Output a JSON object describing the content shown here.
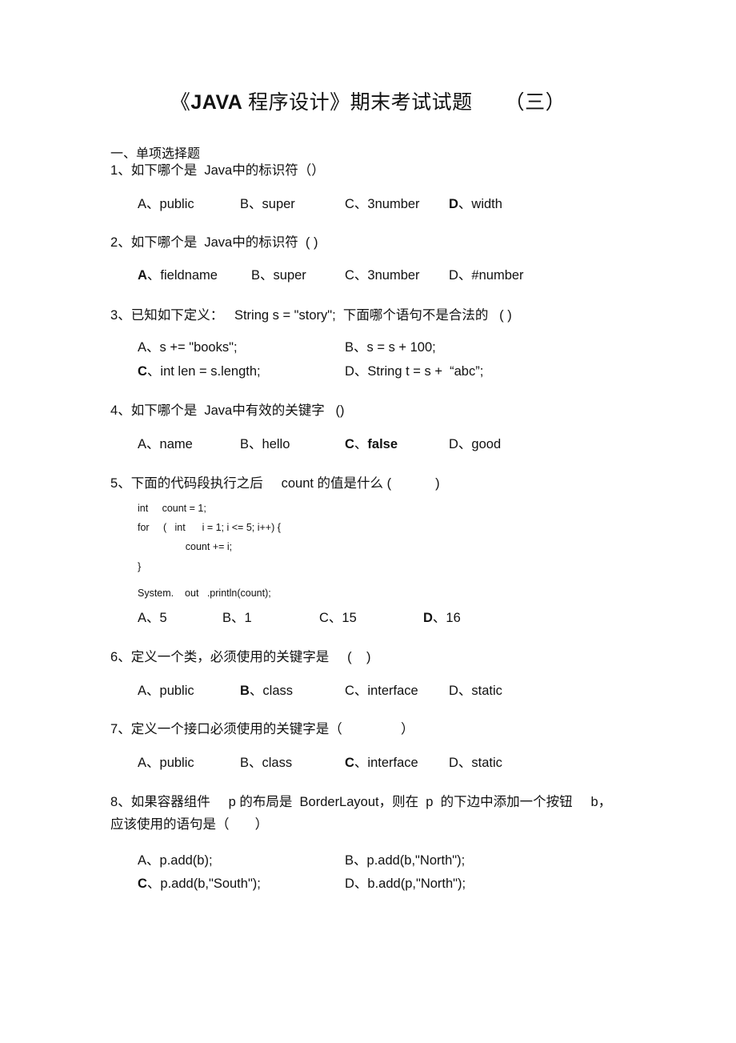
{
  "title": {
    "open": "《",
    "java": "JAVA",
    "rest": " 程序设计》期末考试试题",
    "suffix": "（三）"
  },
  "section": "一、单项选择题",
  "sep": "、",
  "questions": [
    {
      "number": "1",
      "text": "如下哪个是  Java中的标识符（）",
      "options": [
        {
          "letter": "A",
          "text": "public"
        },
        {
          "letter": "B",
          "text": "super"
        },
        {
          "letter": "C",
          "text": "3number"
        },
        {
          "letter": "D",
          "text": "width",
          "marked": true
        }
      ]
    },
    {
      "number": "2",
      "text": "如下哪个是  Java中的标识符  ( )",
      "options": [
        {
          "letter": "A",
          "text": "fieldname",
          "marked": true
        },
        {
          "letter": "B",
          "text": "super"
        },
        {
          "letter": "C",
          "text": "3number"
        },
        {
          "letter": "D",
          "text": "#number"
        }
      ]
    },
    {
      "number": "3",
      "text": "已知如下定义：   String s = \"story\";  下面哪个语句不是合法的   ( )",
      "options": [
        {
          "letter": "A",
          "text": "s += \"books\";"
        },
        {
          "letter": "B",
          "text": "s = s + 100;"
        },
        {
          "letter": "C",
          "text": "int len = s.length;",
          "marked": true
        },
        {
          "letter": "D",
          "text": "String t = s +  “abc”;"
        }
      ]
    },
    {
      "number": "4",
      "text": "如下哪个是  Java中有效的关键字   ()",
      "options": [
        {
          "letter": "A",
          "text": "name"
        },
        {
          "letter": "B",
          "text": "hello"
        },
        {
          "letter": "C",
          "text": "false",
          "marked": true
        },
        {
          "letter": "D",
          "text": "good"
        }
      ]
    },
    {
      "number": "5",
      "text": "下面的代码段执行之后     count 的值是什么 (            )",
      "code": [
        "int     count = 1;",
        "for     (   int      i = 1; i <= 5; i++) {",
        "        count += i;",
        "}",
        "System.    out   .println(count);"
      ],
      "options": [
        {
          "letter": "A",
          "text": "5"
        },
        {
          "letter": "B",
          "text": "1"
        },
        {
          "letter": "C",
          "text": "15"
        },
        {
          "letter": "D",
          "text": "16",
          "marked": true
        }
      ]
    },
    {
      "number": "6",
      "text": "定义一个类，必须使用的关键字是     (    )",
      "options": [
        {
          "letter": "A",
          "text": "public"
        },
        {
          "letter": "B",
          "text": "class",
          "marked": true
        },
        {
          "letter": "C",
          "text": "interface"
        },
        {
          "letter": "D",
          "text": "static"
        }
      ]
    },
    {
      "number": "7",
      "text": "定义一个接口必须使用的关键字是（                ）",
      "options": [
        {
          "letter": "A",
          "text": "public"
        },
        {
          "letter": "B",
          "text": "class"
        },
        {
          "letter": "C",
          "text": "interface",
          "marked": true
        },
        {
          "letter": "D",
          "text": "static"
        }
      ]
    },
    {
      "number": "8",
      "text": "如果容器组件     p 的布局是  BorderLayout，则在  p  的下边中添加一个按钮     b，",
      "text2": "应该使用的语句是（       ）",
      "options": [
        {
          "letter": "A",
          "text": "p.add(b);"
        },
        {
          "letter": "B",
          "text": "p.add(b,\"North\");"
        },
        {
          "letter": "C",
          "text": "p.add(b,\"South\");",
          "marked": true
        },
        {
          "letter": "D",
          "text": "b.add(p,\"North\");"
        }
      ]
    }
  ]
}
